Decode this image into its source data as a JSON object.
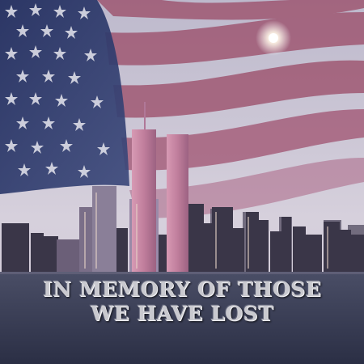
{
  "caption": {
    "line1": "IN MEMORY OF THOSE",
    "line2": "WE HAVE LOST"
  },
  "colors": {
    "sky_top": "#b9b6c9",
    "sky_bottom": "#d7d2dc",
    "stripe_red": "#9a4a66",
    "canton_blue": "#2c3a6e",
    "star_white": "#e6e6ee",
    "skyline_dark": "#3a3648",
    "tower_pink": "#c98aa6",
    "water": "#3b3f56",
    "text_silver": "#c9c9cf"
  },
  "icons": [
    "american-flag",
    "world-trade-center-towers",
    "city-skyline",
    "moon"
  ]
}
